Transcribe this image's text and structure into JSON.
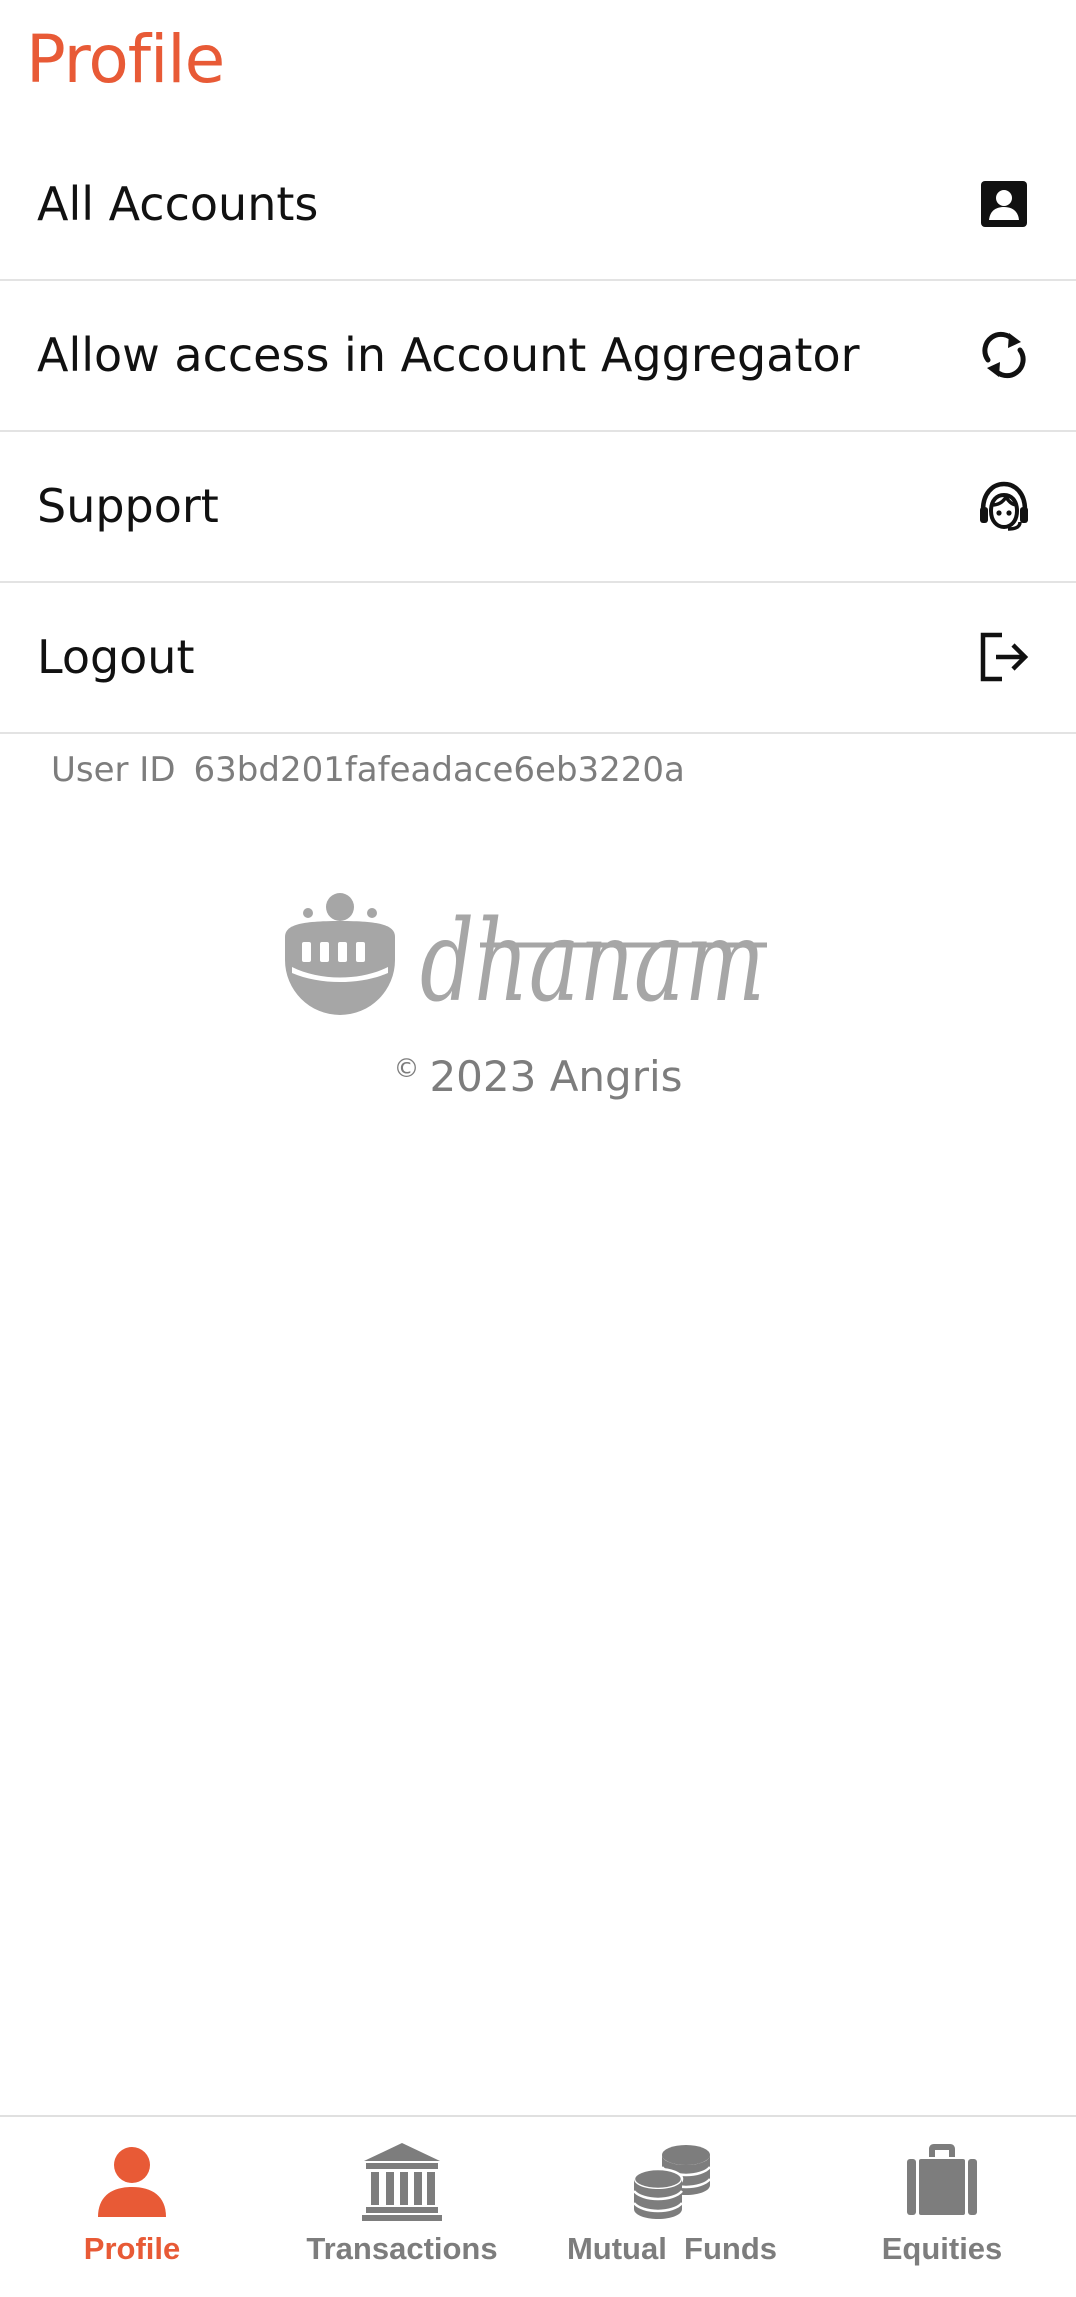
{
  "colors": {
    "accent": "#e85a36",
    "text_primary": "#111111",
    "text_muted": "#7d7d7d",
    "divider": "#e3e3e3",
    "nav_inactive": "#7d7d7d",
    "logo_gray": "#a6a6a6"
  },
  "header": {
    "title": "Profile"
  },
  "menu": {
    "items": [
      {
        "label": "All Accounts",
        "icon": "account-box-icon"
      },
      {
        "label": "Allow access in Account Aggregator",
        "icon": "sync-icon"
      },
      {
        "label": "Support",
        "icon": "support-agent-icon"
      },
      {
        "label": "Logout",
        "icon": "logout-icon"
      }
    ]
  },
  "user": {
    "id_label": "User ID",
    "id_value": "63bd201fafeadace6eb3220a"
  },
  "brand": {
    "logo_text": "dhanam",
    "copyright_symbol": "©",
    "copyright_text": "2023 Angris"
  },
  "bottom_nav": {
    "active": "Profile",
    "tabs": [
      {
        "label": "Profile",
        "icon": "person-icon"
      },
      {
        "label": "Transactions",
        "icon": "bank-icon"
      },
      {
        "label": "Mutual  Funds",
        "icon": "coins-stack-icon"
      },
      {
        "label": "Equities",
        "icon": "briefcase-icon"
      }
    ]
  }
}
